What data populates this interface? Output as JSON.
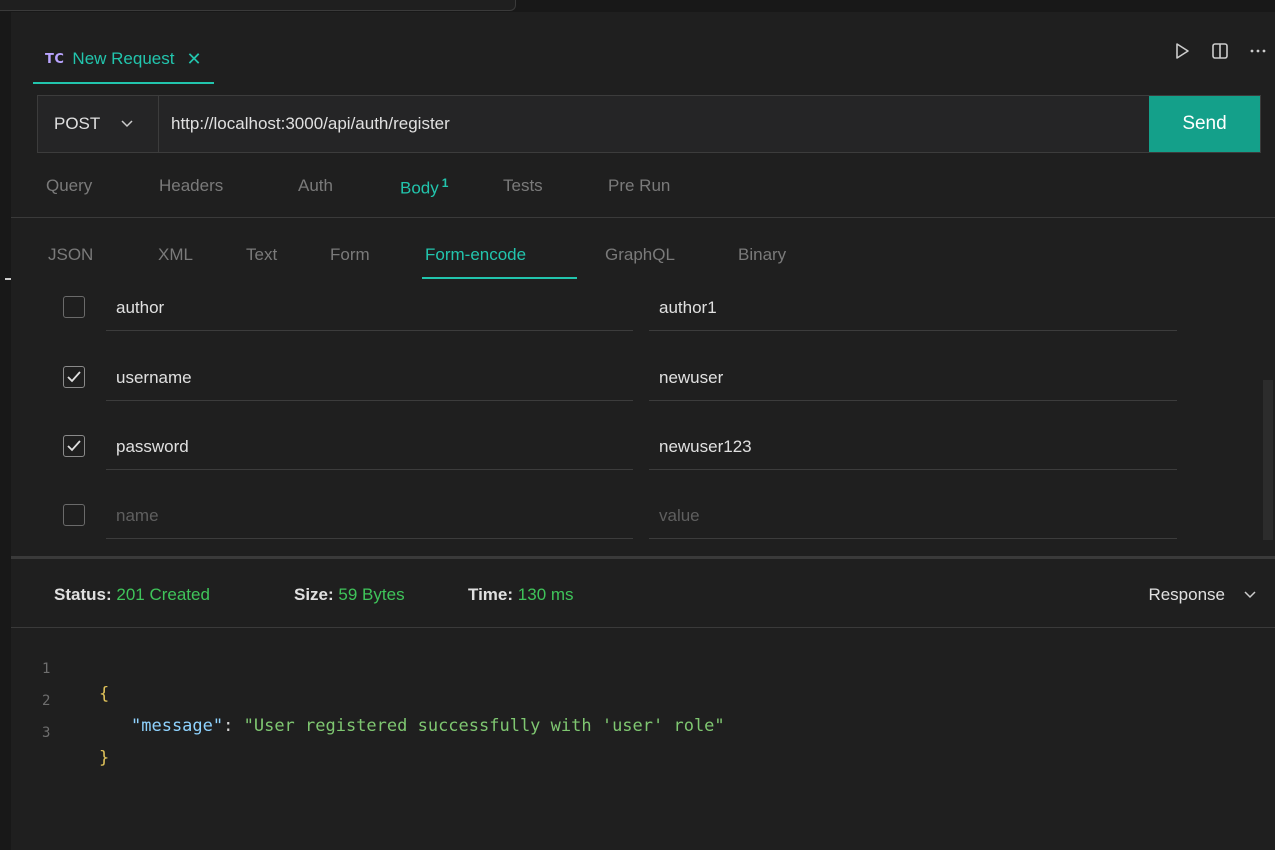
{
  "editor_tab": {
    "icon": "TC",
    "title": "New Request",
    "close": "✕"
  },
  "request": {
    "method": "POST",
    "url": "http://localhost:3000/api/auth/register",
    "send_label": "Send"
  },
  "request_tabs": [
    {
      "label": "Query"
    },
    {
      "label": "Headers"
    },
    {
      "label": "Auth"
    },
    {
      "label": "Body",
      "badge": "1",
      "active": true
    },
    {
      "label": "Tests"
    },
    {
      "label": "Pre Run"
    }
  ],
  "body_tabs": [
    {
      "label": "JSON"
    },
    {
      "label": "XML"
    },
    {
      "label": "Text"
    },
    {
      "label": "Form"
    },
    {
      "label": "Form-encode",
      "active": true
    },
    {
      "label": "GraphQL"
    },
    {
      "label": "Binary"
    }
  ],
  "form_rows": [
    {
      "checked": false,
      "key": "author",
      "value": "author1"
    },
    {
      "checked": true,
      "key": "username",
      "value": "newuser"
    },
    {
      "checked": true,
      "key": "password",
      "value": "newuser123"
    }
  ],
  "empty_row": {
    "key_placeholder": "name",
    "value_placeholder": "value"
  },
  "response": {
    "status_label": "Status:",
    "status_value": "201 Created",
    "size_label": "Size:",
    "size_value": "59 Bytes",
    "time_label": "Time:",
    "time_value": "130 ms",
    "view_select": "Response"
  },
  "response_body": {
    "line_numbers": [
      "1",
      "2",
      "3"
    ],
    "open_brace": "{",
    "key": "\"message\"",
    "colon": ": ",
    "value": "\"User registered successfully with 'user' role\"",
    "close_brace": "}"
  },
  "colors": {
    "accent": "#22c5ad",
    "send": "#14a08a",
    "status_ok": "#3fc45a",
    "background": "#1f1f1f"
  }
}
